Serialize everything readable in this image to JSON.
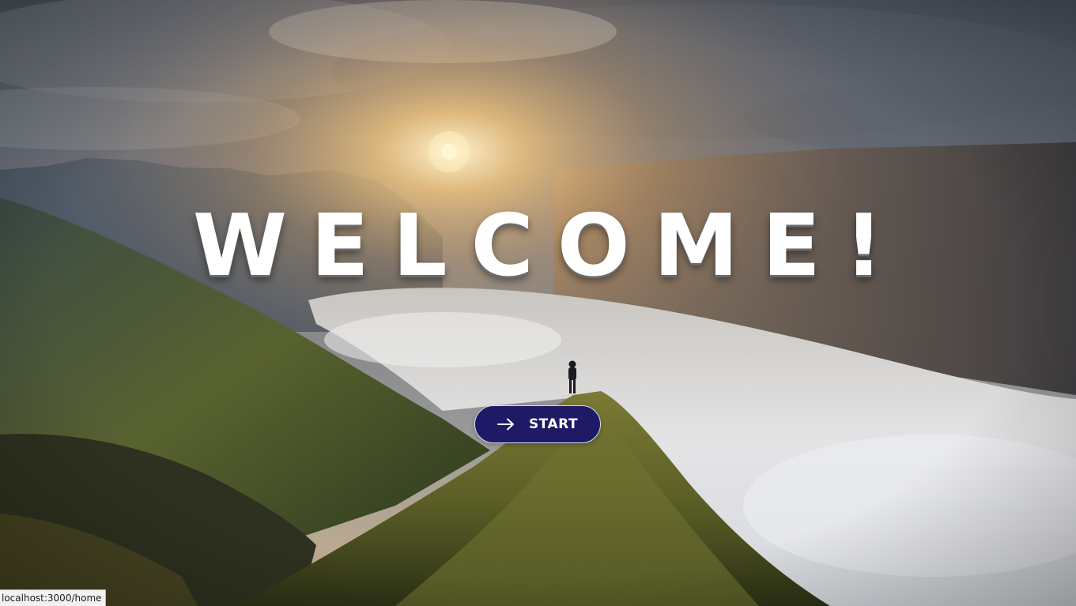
{
  "hero": {
    "title": "WELCOME!",
    "background_icon": "mountain-landscape-image"
  },
  "start_button": {
    "label": "START",
    "icon": "arrow-right-icon",
    "background_color": "#1e1a66",
    "text_color": "#ffffff"
  },
  "status_bar": {
    "url": "localhost:3000/home"
  }
}
